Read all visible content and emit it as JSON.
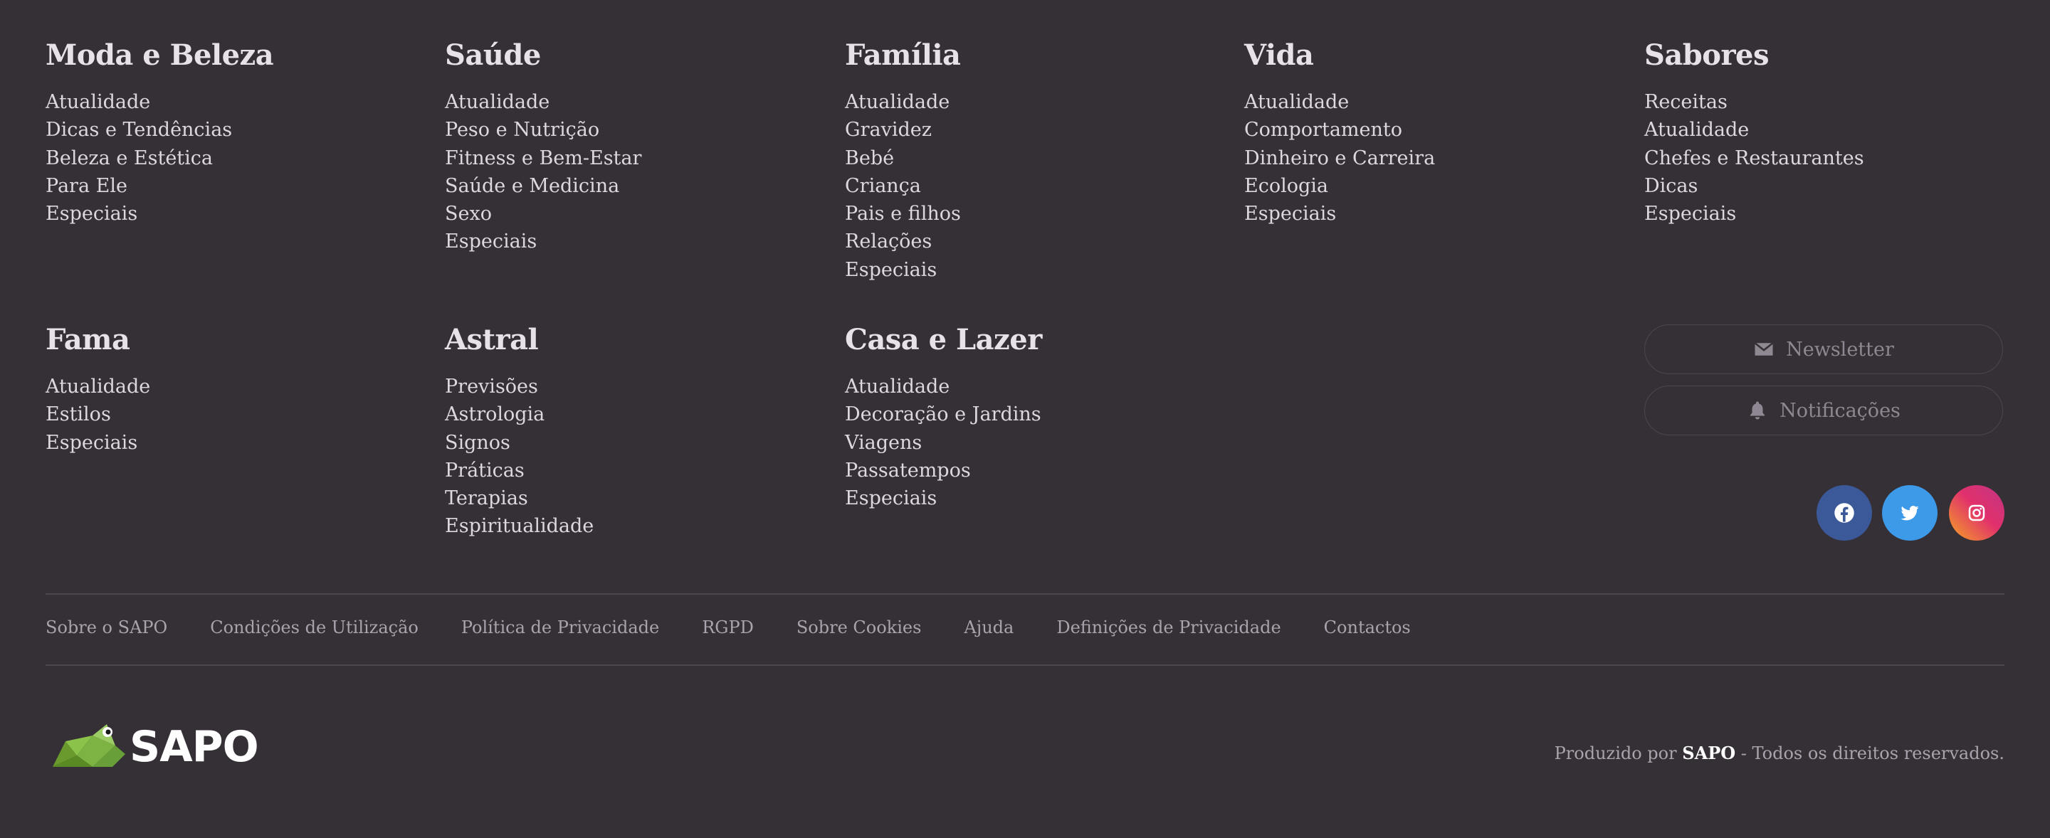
{
  "sections": [
    {
      "title": "Moda e Beleza",
      "items": [
        "Atualidade",
        "Dicas e Tendências",
        "Beleza e Estética",
        "Para Ele",
        "Especiais"
      ]
    },
    {
      "title": "Saúde",
      "items": [
        "Atualidade",
        "Peso e Nutrição",
        "Fitness e Bem-Estar",
        "Saúde e Medicina",
        "Sexo",
        "Especiais"
      ]
    },
    {
      "title": "Família",
      "items": [
        "Atualidade",
        "Gravidez",
        "Bebé",
        "Criança",
        "Pais e filhos",
        "Relações",
        "Especiais"
      ]
    },
    {
      "title": "Vida",
      "items": [
        "Atualidade",
        "Comportamento",
        "Dinheiro e Carreira",
        "Ecologia",
        "Especiais"
      ]
    },
    {
      "title": "Sabores",
      "items": [
        "Receitas",
        "Atualidade",
        "Chefes e Restaurantes",
        "Dicas",
        "Especiais"
      ]
    },
    {
      "title": "Fama",
      "items": [
        "Atualidade",
        "Estilos",
        "Especiais"
      ]
    },
    {
      "title": "Astral",
      "items": [
        "Previsões",
        "Astrologia",
        "Signos",
        "Práticas",
        "Terapias",
        "Espiritualidade"
      ]
    },
    {
      "title": "Casa e Lazer",
      "items": [
        "Atualidade",
        "Decoração e Jardins",
        "Viagens",
        "Passatempos",
        "Especiais"
      ]
    }
  ],
  "actions": {
    "newsletter": {
      "label": "Newsletter",
      "icon": "envelope-icon"
    },
    "notifications": {
      "label": "Notificações",
      "icon": "bell-icon"
    }
  },
  "social": [
    {
      "name": "facebook",
      "icon": "facebook-icon",
      "color": "#3b5998"
    },
    {
      "name": "twitter",
      "icon": "twitter-icon",
      "color": "#3d9ae8"
    },
    {
      "name": "instagram",
      "icon": "instagram-icon",
      "color": "#d8366b"
    }
  ],
  "legal_links": [
    "Sobre o SAPO",
    "Condições de Utilização",
    "Política de Privacidade",
    "RGPD",
    "Sobre Cookies",
    "Ajuda",
    "Definições de Privacidade",
    "Contactos"
  ],
  "brand": {
    "name": "SAPO",
    "frog_color": "#7cb342"
  },
  "copyright": {
    "prefix": "Produzido por",
    "brand": "SAPO",
    "suffix": "- Todos os direitos reservados."
  }
}
